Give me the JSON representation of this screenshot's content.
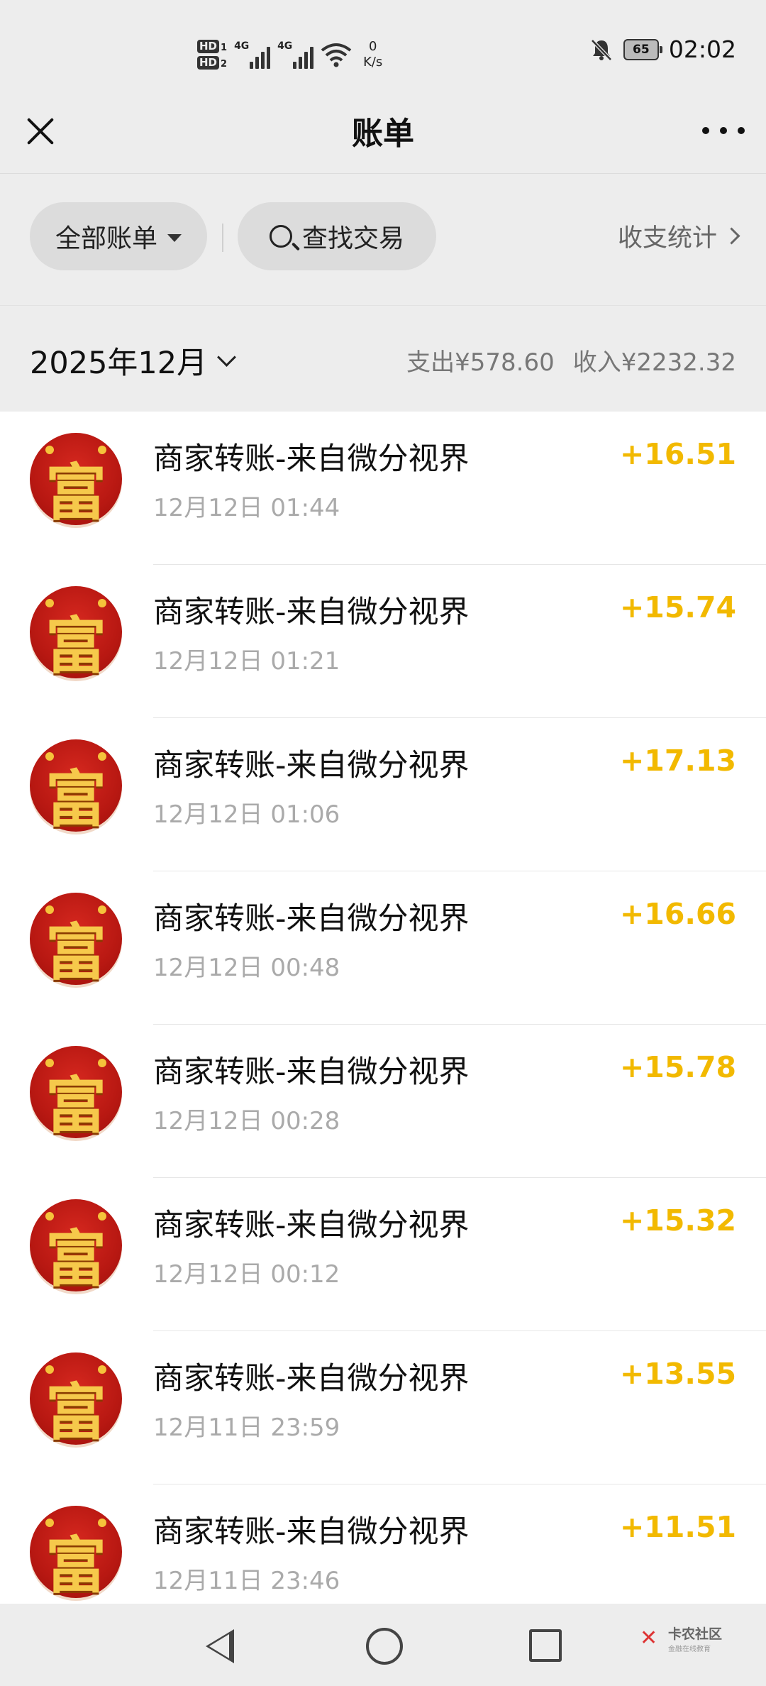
{
  "status_bar": {
    "hd1": "HD",
    "hd1_sub": "1",
    "hd2": "HD",
    "hd2_sub": "2",
    "net1": "4G",
    "net2": "4G",
    "speed_value": "0",
    "speed_unit": "K/s",
    "battery": "65",
    "time": "02:02"
  },
  "header": {
    "title": "账单"
  },
  "filters": {
    "all_bills": "全部账单",
    "search": "查找交易",
    "stats": "收支统计"
  },
  "month_bar": {
    "month": "2025年12月",
    "expense": "支出¥578.60",
    "income": "收入¥2232.32"
  },
  "transactions": [
    {
      "title": "商家转账-来自微分视界",
      "time": "12月12日 01:44",
      "amount": "+16.51"
    },
    {
      "title": "商家转账-来自微分视界",
      "time": "12月12日 01:21",
      "amount": "+15.74"
    },
    {
      "title": "商家转账-来自微分视界",
      "time": "12月12日 01:06",
      "amount": "+17.13"
    },
    {
      "title": "商家转账-来自微分视界",
      "time": "12月12日 00:48",
      "amount": "+16.66"
    },
    {
      "title": "商家转账-来自微分视界",
      "time": "12月12日 00:28",
      "amount": "+15.78"
    },
    {
      "title": "商家转账-来自微分视界",
      "time": "12月12日 00:12",
      "amount": "+15.32"
    },
    {
      "title": "商家转账-来自微分视界",
      "time": "12月11日 23:59",
      "amount": "+13.55"
    },
    {
      "title": "商家转账-来自微分视界",
      "time": "12月11日 23:46",
      "amount": "+11.51"
    }
  ],
  "avatar_char": "富",
  "watermark": {
    "name": "卡农社区",
    "tagline": "金融在线教育"
  },
  "colors": {
    "income": "#f2b900",
    "background": "#ededed"
  }
}
